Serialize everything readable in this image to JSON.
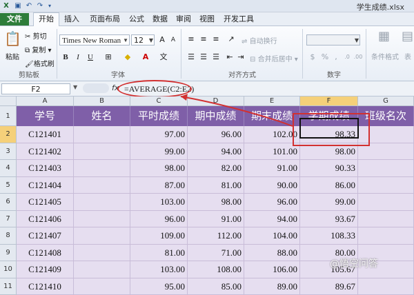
{
  "window": {
    "title": "学生成绩.xlsx"
  },
  "ribbon_tabs": [
    "文件",
    "开始",
    "插入",
    "页面布局",
    "公式",
    "数据",
    "审阅",
    "视图",
    "开发工具"
  ],
  "ribbon": {
    "clipboard": {
      "paste": "粘贴",
      "cut": "剪切",
      "copy": "复制",
      "format_painter": "格式刷",
      "label": "剪贴板"
    },
    "font": {
      "name": "Times New Roman",
      "size": "12",
      "label": "字体"
    },
    "alignment": {
      "wrap": "自动换行",
      "merge": "合并后居中",
      "label": "对齐方式"
    },
    "number": {
      "label": "数字"
    },
    "styles": {
      "cond_format": "条件格式",
      "table_format": "表"
    }
  },
  "formula_bar": {
    "name_box": "F2",
    "fx": "fx",
    "formula": "=AVERAGE(C2:E2)"
  },
  "columns": [
    "A",
    "B",
    "C",
    "D",
    "E",
    "F",
    "G"
  ],
  "header_row": [
    "学号",
    "姓名",
    "平时成绩",
    "期中成绩",
    "期末成绩",
    "学期成绩",
    "班级名次"
  ],
  "rows": [
    {
      "n": "2",
      "id": "C121401",
      "usual": "97.00",
      "mid": "96.00",
      "final": "102.00",
      "term": "98.33"
    },
    {
      "n": "3",
      "id": "C121402",
      "usual": "99.00",
      "mid": "94.00",
      "final": "101.00",
      "term": "98.00"
    },
    {
      "n": "4",
      "id": "C121403",
      "usual": "98.00",
      "mid": "82.00",
      "final": "91.00",
      "term": "90.33"
    },
    {
      "n": "5",
      "id": "C121404",
      "usual": "87.00",
      "mid": "81.00",
      "final": "90.00",
      "term": "86.00"
    },
    {
      "n": "6",
      "id": "C121405",
      "usual": "103.00",
      "mid": "98.00",
      "final": "96.00",
      "term": "99.00"
    },
    {
      "n": "7",
      "id": "C121406",
      "usual": "96.00",
      "mid": "91.00",
      "final": "94.00",
      "term": "93.67"
    },
    {
      "n": "8",
      "id": "C121407",
      "usual": "109.00",
      "mid": "112.00",
      "final": "104.00",
      "term": "108.33"
    },
    {
      "n": "9",
      "id": "C121408",
      "usual": "81.00",
      "mid": "71.00",
      "final": "88.00",
      "term": "80.00"
    },
    {
      "n": "10",
      "id": "C121409",
      "usual": "103.00",
      "mid": "108.00",
      "final": "106.00",
      "term": "105.67"
    },
    {
      "n": "11",
      "id": "C121410",
      "usual": "95.00",
      "mid": "85.00",
      "final": "89.00",
      "term": "89.67"
    }
  ],
  "header_row_number": "1",
  "watermark": "@悟空问答",
  "colors": {
    "header_fill": "#7f5fa8",
    "cell_fill": "#e6def0",
    "annotation": "#d23030",
    "file_tab": "#2e7d3a"
  }
}
